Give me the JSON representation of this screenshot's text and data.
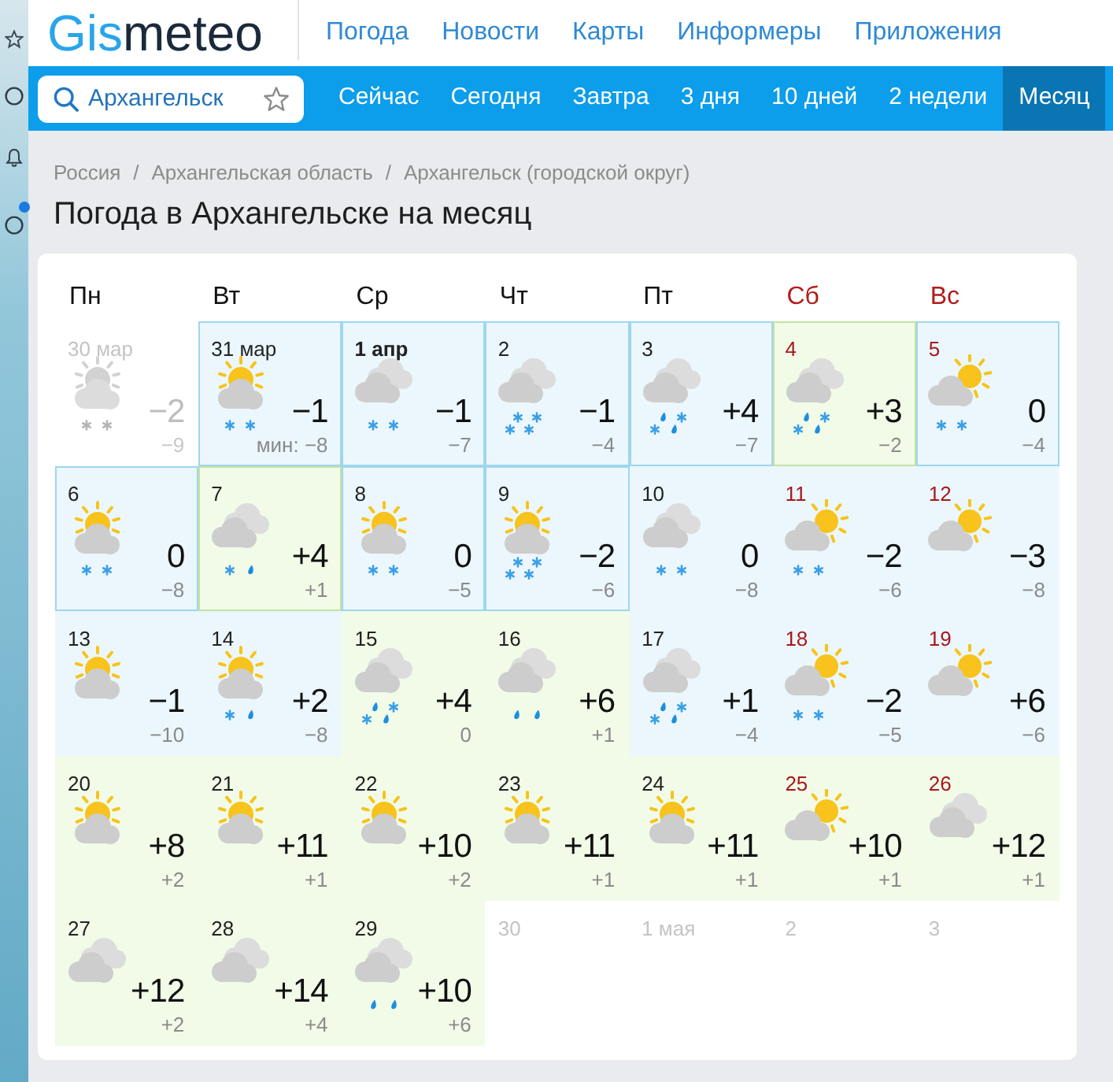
{
  "header": {
    "logo": [
      "Gis",
      "meteo"
    ],
    "nav_links": [
      "Погода",
      "Новости",
      "Карты",
      "Информеры",
      "Приложения"
    ]
  },
  "search": {
    "value": "Архангельск"
  },
  "tabs": [
    {
      "label": "Сейчас",
      "selected": false
    },
    {
      "label": "Сегодня",
      "selected": false
    },
    {
      "label": "Завтра",
      "selected": false
    },
    {
      "label": "3 дня",
      "selected": false
    },
    {
      "label": "10 дней",
      "selected": false
    },
    {
      "label": "2 недели",
      "selected": false
    },
    {
      "label": "Месяц",
      "selected": true
    }
  ],
  "breadcrumb": [
    {
      "kind": "link",
      "text": "Россия"
    },
    {
      "kind": "separator",
      "text": "/"
    },
    {
      "kind": "link",
      "text": "Архангельская область"
    },
    {
      "kind": "separator",
      "text": "/"
    },
    {
      "kind": "link",
      "text": "Архангельск (городской округ)"
    }
  ],
  "title": "Погода в Архангельске на месяц",
  "calendar": {
    "weekdays": [
      {
        "label": "Пн",
        "weekend": false
      },
      {
        "label": "Вт",
        "weekend": false
      },
      {
        "label": "Ср",
        "weekend": false
      },
      {
        "label": "Чт",
        "weekend": false
      },
      {
        "label": "Пт",
        "weekend": false
      },
      {
        "label": "Сб",
        "weekend": true
      },
      {
        "label": "Вс",
        "weekend": true
      }
    ],
    "days": [
      {
        "date": "30 мар",
        "kind": "past",
        "weekend": false,
        "today": false,
        "framed": false,
        "sky": {
          "kind": "sun_cloud"
        },
        "precip": {
          "kind": "snow2"
        },
        "temp": "−2",
        "min": "−9"
      },
      {
        "date": "31 мар",
        "kind": "cold",
        "weekend": false,
        "today": false,
        "framed": true,
        "sky": {
          "kind": "sun_cloud"
        },
        "precip": {
          "kind": "snow2"
        },
        "temp": "−1",
        "min": "мин: −8"
      },
      {
        "date": "1 апр",
        "kind": "cold",
        "weekend": false,
        "today": true,
        "framed": true,
        "sky": {
          "kind": "overcast"
        },
        "precip": {
          "kind": "snow2"
        },
        "temp": "−1",
        "min": "−7"
      },
      {
        "date": "2",
        "kind": "cold",
        "weekend": false,
        "today": false,
        "framed": true,
        "sky": {
          "kind": "overcast"
        },
        "precip": {
          "kind": "snow4"
        },
        "temp": "−1",
        "min": "−4"
      },
      {
        "date": "3",
        "kind": "cold",
        "weekend": false,
        "today": false,
        "framed": true,
        "sky": {
          "kind": "overcast"
        },
        "precip": {
          "kind": "mixed"
        },
        "temp": "+4",
        "min": "−7"
      },
      {
        "date": "4",
        "kind": "warm",
        "weekend": true,
        "today": false,
        "framed": true,
        "sky": {
          "kind": "overcast"
        },
        "precip": {
          "kind": "mixed"
        },
        "temp": "+3",
        "min": "−2"
      },
      {
        "date": "5",
        "kind": "cold",
        "weekend": true,
        "today": false,
        "framed": true,
        "sky": {
          "kind": "sun_behind"
        },
        "precip": {
          "kind": "snow2"
        },
        "temp": "0",
        "min": "−4"
      },
      {
        "date": "6",
        "kind": "cold",
        "weekend": false,
        "today": false,
        "framed": true,
        "sky": {
          "kind": "sun_cloud"
        },
        "precip": {
          "kind": "snow2"
        },
        "temp": "0",
        "min": "−8"
      },
      {
        "date": "7",
        "kind": "warm",
        "weekend": false,
        "today": false,
        "framed": true,
        "sky": {
          "kind": "overcast"
        },
        "precip": {
          "kind": "snow_rain"
        },
        "temp": "+4",
        "min": "+1"
      },
      {
        "date": "8",
        "kind": "cold",
        "weekend": false,
        "today": false,
        "framed": true,
        "sky": {
          "kind": "sun_cloud"
        },
        "precip": {
          "kind": "snow2"
        },
        "temp": "0",
        "min": "−5"
      },
      {
        "date": "9",
        "kind": "cold",
        "weekend": false,
        "today": false,
        "framed": true,
        "sky": {
          "kind": "sun_cloud"
        },
        "precip": {
          "kind": "snow4"
        },
        "temp": "−2",
        "min": "−6"
      },
      {
        "date": "10",
        "kind": "cold",
        "weekend": false,
        "today": false,
        "framed": false,
        "sky": {
          "kind": "overcast"
        },
        "precip": {
          "kind": "snow2"
        },
        "temp": "0",
        "min": "−8"
      },
      {
        "date": "11",
        "kind": "cold",
        "weekend": true,
        "today": false,
        "framed": false,
        "sky": {
          "kind": "sun_behind"
        },
        "precip": {
          "kind": "snow2"
        },
        "temp": "−2",
        "min": "−6"
      },
      {
        "date": "12",
        "kind": "cold",
        "weekend": true,
        "today": false,
        "framed": false,
        "sky": {
          "kind": "sun_behind"
        },
        "temp": "−3",
        "min": "−8"
      },
      {
        "date": "13",
        "kind": "cold",
        "weekend": false,
        "today": false,
        "framed": false,
        "sky": {
          "kind": "sun_cloud"
        },
        "temp": "−1",
        "min": "−10"
      },
      {
        "date": "14",
        "kind": "cold",
        "weekend": false,
        "today": false,
        "framed": false,
        "sky": {
          "kind": "sun_cloud"
        },
        "precip": {
          "kind": "snow_rain"
        },
        "temp": "+2",
        "min": "−8"
      },
      {
        "date": "15",
        "kind": "warm",
        "weekend": false,
        "today": false,
        "framed": false,
        "sky": {
          "kind": "overcast"
        },
        "precip": {
          "kind": "mixed"
        },
        "temp": "+4",
        "min": "0"
      },
      {
        "date": "16",
        "kind": "warm",
        "weekend": false,
        "today": false,
        "framed": false,
        "sky": {
          "kind": "overcast"
        },
        "precip": {
          "kind": "rain2"
        },
        "temp": "+6",
        "min": "+1"
      },
      {
        "date": "17",
        "kind": "cold",
        "weekend": false,
        "today": false,
        "framed": false,
        "sky": {
          "kind": "overcast"
        },
        "precip": {
          "kind": "mixed"
        },
        "temp": "+1",
        "min": "−4"
      },
      {
        "date": "18",
        "kind": "cold",
        "weekend": true,
        "today": false,
        "framed": false,
        "sky": {
          "kind": "sun_behind"
        },
        "precip": {
          "kind": "snow2"
        },
        "temp": "−2",
        "min": "−5"
      },
      {
        "date": "19",
        "kind": "cold",
        "weekend": true,
        "today": false,
        "framed": false,
        "sky": {
          "kind": "sun_behind"
        },
        "temp": "+6",
        "min": "−6"
      },
      {
        "date": "20",
        "kind": "warm",
        "weekend": false,
        "today": false,
        "framed": false,
        "sky": {
          "kind": "sun_cloud"
        },
        "temp": "+8",
        "min": "+2"
      },
      {
        "date": "21",
        "kind": "warm",
        "weekend": false,
        "today": false,
        "framed": false,
        "sky": {
          "kind": "sun_cloud"
        },
        "temp": "+11",
        "min": "+1"
      },
      {
        "date": "22",
        "kind": "warm",
        "weekend": false,
        "today": false,
        "framed": false,
        "sky": {
          "kind": "sun_cloud"
        },
        "temp": "+10",
        "min": "+2"
      },
      {
        "date": "23",
        "kind": "warm",
        "weekend": false,
        "today": false,
        "framed": false,
        "sky": {
          "kind": "sun_cloud"
        },
        "temp": "+11",
        "min": "+1"
      },
      {
        "date": "24",
        "kind": "warm",
        "weekend": false,
        "today": false,
        "framed": false,
        "sky": {
          "kind": "sun_cloud"
        },
        "temp": "+11",
        "min": "+1"
      },
      {
        "date": "25",
        "kind": "warm",
        "weekend": true,
        "today": false,
        "framed": false,
        "sky": {
          "kind": "sun_behind"
        },
        "temp": "+10",
        "min": "+1"
      },
      {
        "date": "26",
        "kind": "warm",
        "weekend": true,
        "today": false,
        "framed": false,
        "sky": {
          "kind": "overcast"
        },
        "temp": "+12",
        "min": "+1"
      },
      {
        "date": "27",
        "kind": "warm",
        "weekend": false,
        "today": false,
        "framed": false,
        "sky": {
          "kind": "overcast"
        },
        "temp": "+12",
        "min": "+2"
      },
      {
        "date": "28",
        "kind": "warm",
        "weekend": false,
        "today": false,
        "framed": false,
        "sky": {
          "kind": "overcast"
        },
        "temp": "+14",
        "min": "+4"
      },
      {
        "date": "29",
        "kind": "warm",
        "weekend": false,
        "today": false,
        "framed": false,
        "sky": {
          "kind": "overcast"
        },
        "precip": {
          "kind": "rain2"
        },
        "temp": "+10",
        "min": "+6"
      },
      {
        "date": "30",
        "kind": "outside",
        "weekend": false,
        "today": false,
        "framed": false
      },
      {
        "date": "1 мая",
        "kind": "outside",
        "weekend": false,
        "today": false,
        "framed": false
      },
      {
        "date": "2",
        "kind": "outside",
        "weekend": false,
        "today": false,
        "framed": false
      },
      {
        "date": "3",
        "kind": "outside",
        "weekend": false,
        "today": false,
        "framed": false
      }
    ]
  }
}
